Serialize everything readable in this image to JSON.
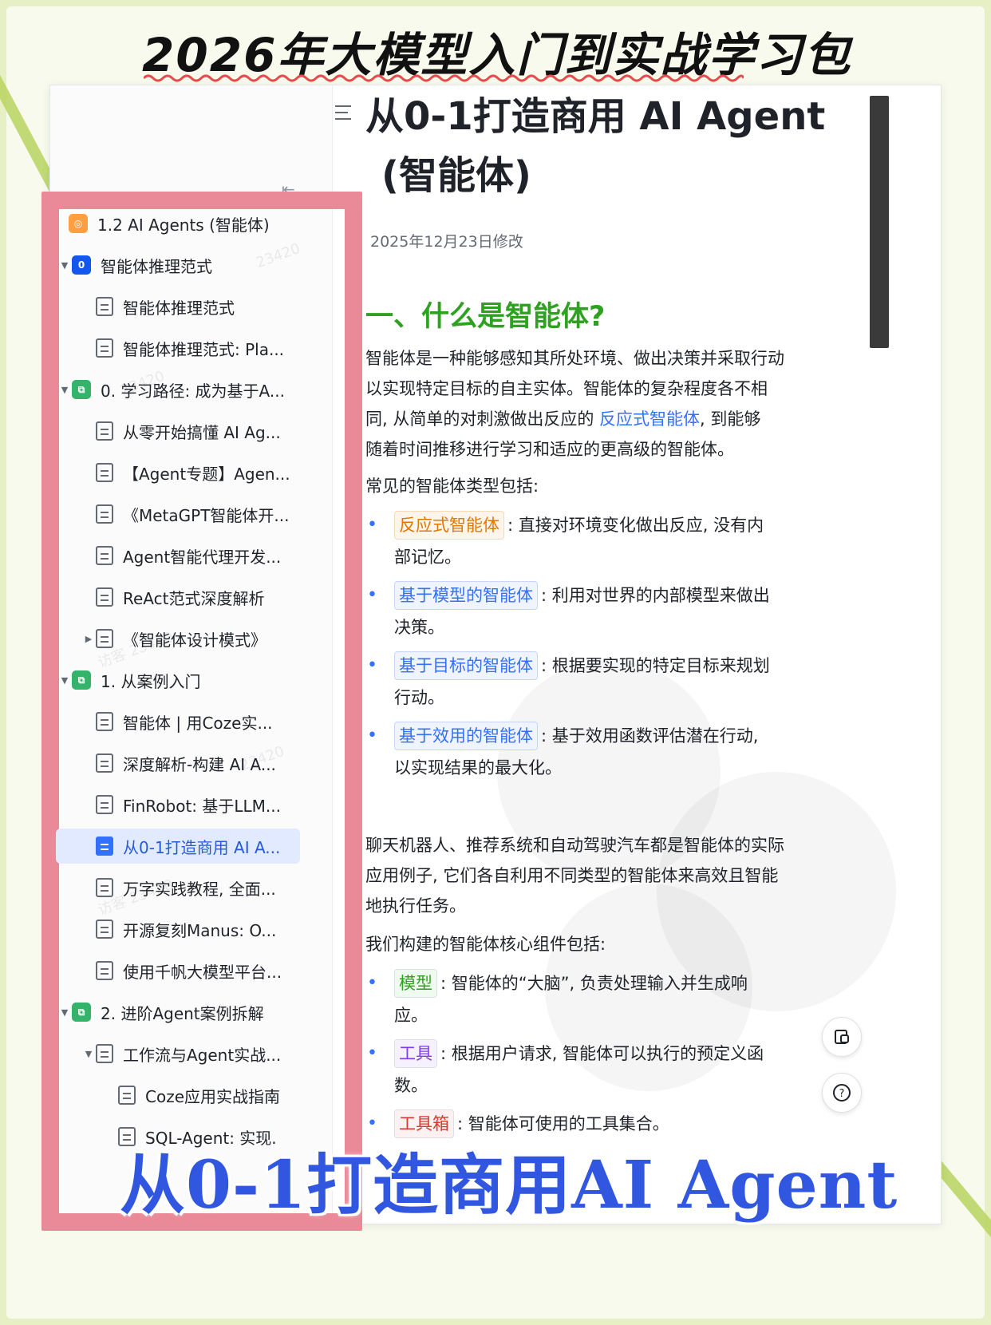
{
  "headline": "2026年大模型入门到实战学习包",
  "banner": "从0-1打造商用AI Agent",
  "sidebar": {
    "root": "1.2 AI Agents (智能体)",
    "items": [
      {
        "label": "智能体推理范式",
        "type": "folder",
        "badge": "0",
        "color": "#1456f0",
        "level": 1
      },
      {
        "label": "智能体推理范式",
        "type": "doc",
        "level": 2
      },
      {
        "label": "智能体推理范式: Pla...",
        "type": "doc",
        "level": 2
      },
      {
        "label": "0. 学习路径: 成为基于A...",
        "type": "folder",
        "color": "#34b36b",
        "level": 1
      },
      {
        "label": "从零开始搞懂 AI Ag...",
        "type": "doc",
        "level": 2
      },
      {
        "label": "【Agent专题】Agen...",
        "type": "doc",
        "level": 2
      },
      {
        "label": "《MetaGPT智能体开...",
        "type": "doc",
        "level": 2
      },
      {
        "label": "Agent智能代理开发...",
        "type": "doc",
        "level": 2
      },
      {
        "label": "ReAct范式深度解析",
        "type": "doc",
        "level": 2
      },
      {
        "label": "《智能体设计模式》",
        "type": "doc",
        "level": 2,
        "expandable": true
      },
      {
        "label": "1. 从案例入门",
        "type": "folder",
        "color": "#34b36b",
        "level": 1
      },
      {
        "label": "智能体 | 用Coze实...",
        "type": "doc",
        "level": 2
      },
      {
        "label": "深度解析-构建 AI A...",
        "type": "doc",
        "level": 2
      },
      {
        "label": "FinRobot: 基于LLM...",
        "type": "doc",
        "level": 2
      },
      {
        "label": "从0-1打造商用 AI A...",
        "type": "doc",
        "level": 2,
        "active": true
      },
      {
        "label": "万字实践教程, 全面...",
        "type": "doc",
        "level": 2
      },
      {
        "label": "开源复刻Manus: O...",
        "type": "doc",
        "level": 2
      },
      {
        "label": "使用千帆大模型平台...",
        "type": "doc",
        "level": 2
      },
      {
        "label": "2. 进阶Agent案例拆解",
        "type": "folder",
        "color": "#34b36b",
        "level": 1
      },
      {
        "label": "工作流与Agent实战...",
        "type": "doc",
        "level": 2,
        "expanded": true
      },
      {
        "label": "Coze应用实战指南",
        "type": "doc",
        "level": 3
      },
      {
        "label": "SQL-Agent: 实现.",
        "type": "doc",
        "level": 3
      }
    ]
  },
  "doc": {
    "title_line1": "从0-1打造商用 AI Agent",
    "title_line2": "(智能体)",
    "modified": "2025年12月23日修改",
    "section1": "一、什么是智能体?",
    "para1_a": "智能体是一种能够感知其所处环境、做出决策并采取行动",
    "para1_b": "以实现特定目标的自主实体。智能体的复杂程度各不相",
    "para1_c": "同, 从简单的对刺激做出反应的",
    "para1_link": "反应式智能体",
    "para1_d": ", 到能够",
    "para1_e": "随着时间推移进行学习和适应的更高级的智能体。",
    "types_intro": "常见的智能体类型包括:",
    "types": [
      {
        "tag": "反应式智能体",
        "text1": ": 直接对环境变化做出反应, 没有内",
        "text2": "部记忆。"
      },
      {
        "tag": "基于模型的智能体",
        "text1": ": 利用对世界的内部模型来做出",
        "text2": "决策。"
      },
      {
        "tag": "基于目标的智能体",
        "text1": ": 根据要实现的特定目标来规划",
        "text2": "行动。"
      },
      {
        "tag": "基于效用的智能体",
        "text1": ": 基于效用函数评估潜在行动,",
        "text2": "以实现结果的最大化。"
      }
    ],
    "para2_a": "聊天机器人、推荐系统和自动驾驶汽车都是智能体的实际",
    "para2_b": "应用例子, 它们各自利用不同类型的智能体来高效且智能",
    "para2_c": "地执行任务。",
    "components_intro": "我们构建的智能体核心组件包括:",
    "components": [
      {
        "tag": "模型",
        "text1": ": 智能体的“大脑”, 负责处理输入并生成响",
        "text2": "应。"
      },
      {
        "tag": "工具",
        "text1": ": 根据用户请求, 智能体可以执行的预定义函",
        "text2": "数。"
      },
      {
        "tag": "工具箱",
        "text1": ": 智能体可使用的工具集合。",
        "text2": ""
      }
    ]
  },
  "watermarks": [
    "23420",
    "23420",
    "访客 23420",
    "23420",
    "访客 23420"
  ]
}
